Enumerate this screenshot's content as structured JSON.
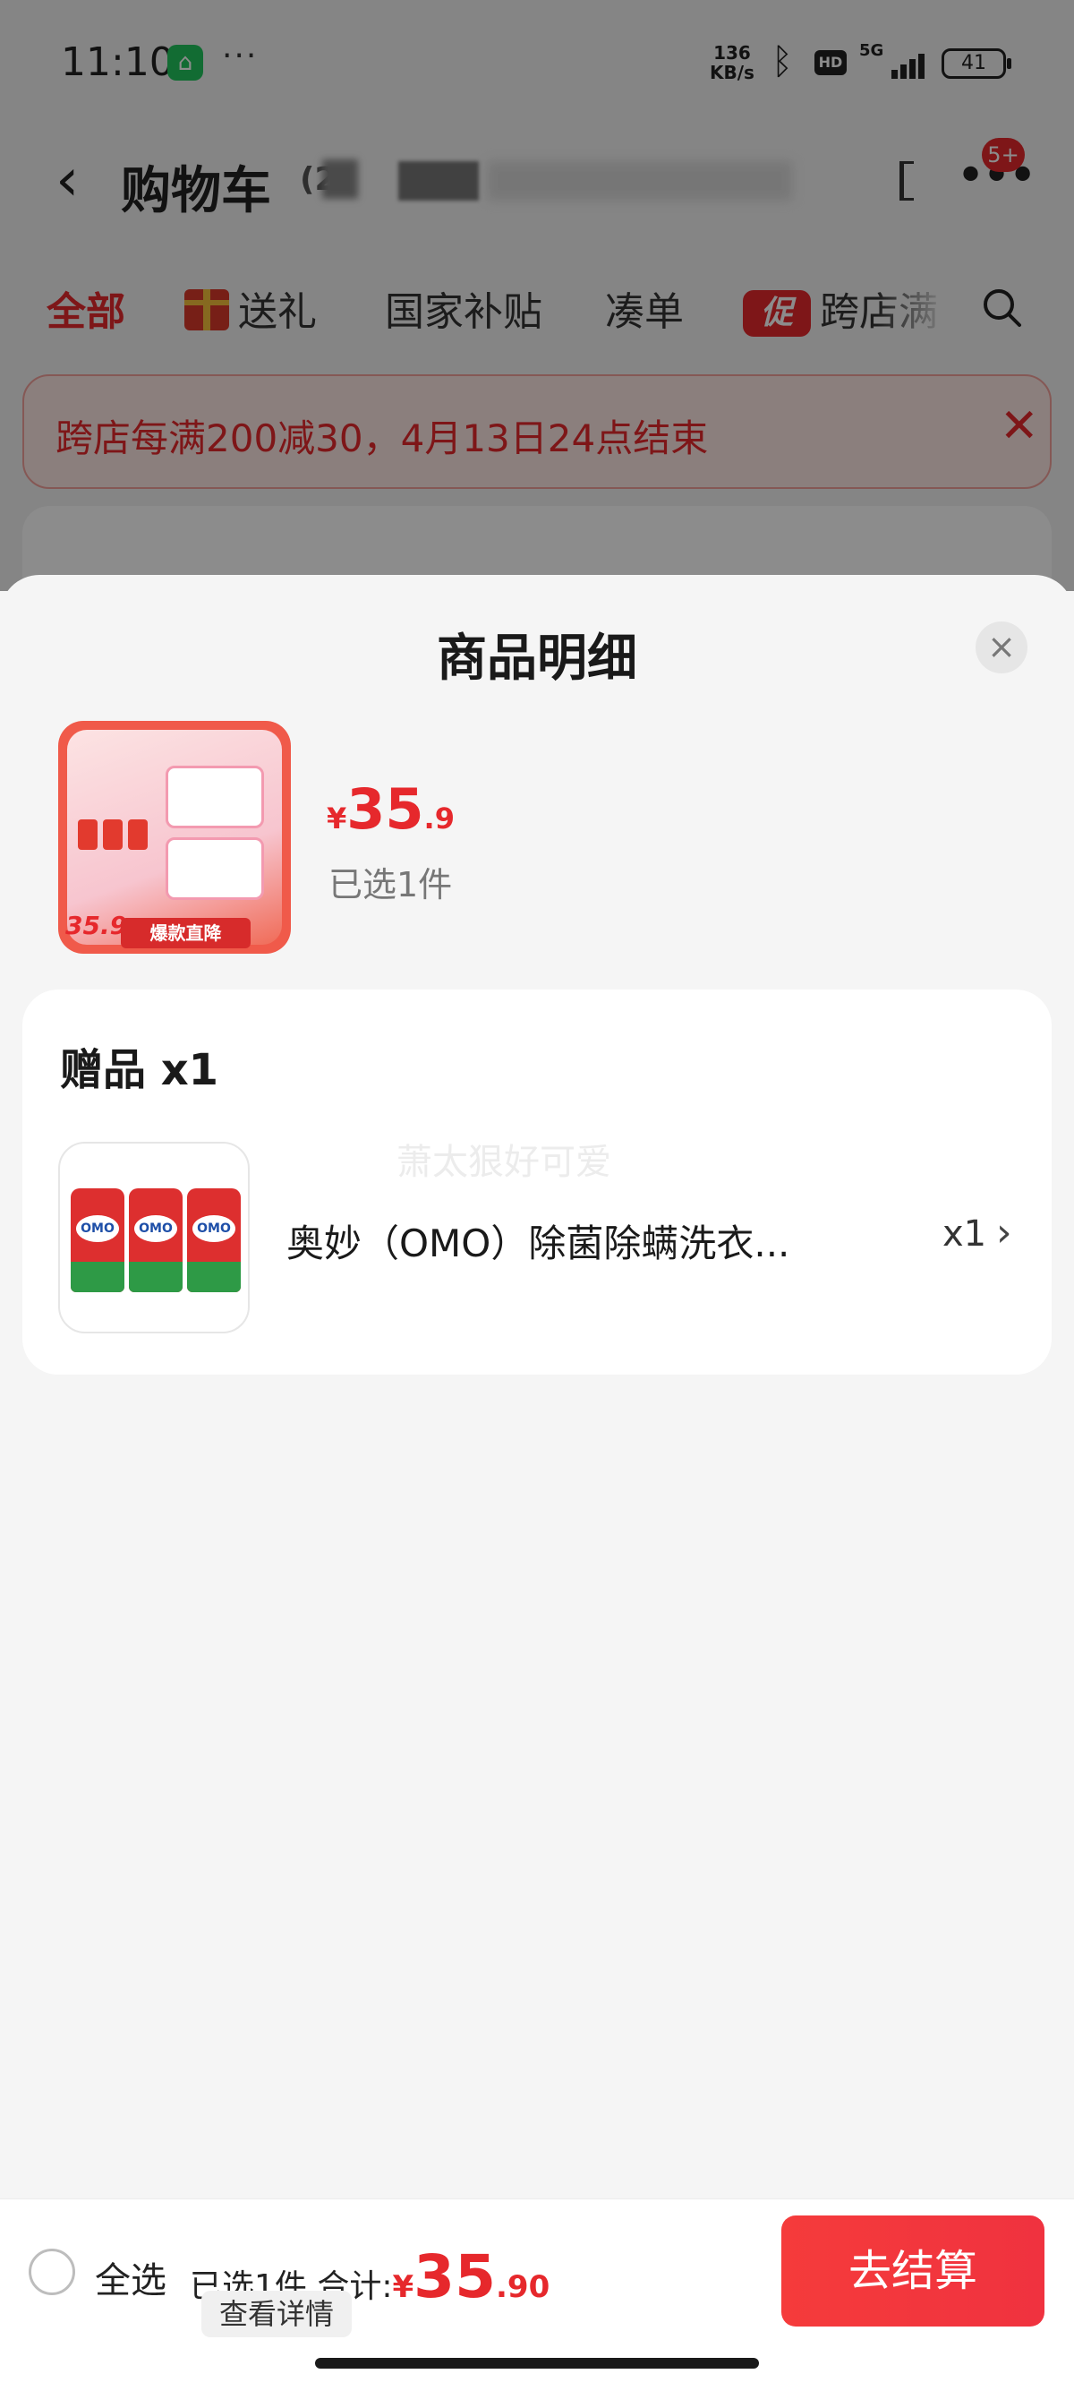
{
  "status_bar": {
    "time": "11:10",
    "more": "···",
    "net_speed_value": "136",
    "net_speed_unit": "KB/s",
    "hd": "HD",
    "signal": "5G",
    "battery": "41"
  },
  "navbar": {
    "title": "购物车",
    "count_prefix": "(2",
    "right_icon": "ledger-icon",
    "more_badge": "5+"
  },
  "tabs": [
    {
      "label": "全部",
      "active": true
    },
    {
      "label": "送礼",
      "icon": "gift-icon"
    },
    {
      "label": "国家补贴"
    },
    {
      "label": "凑单"
    },
    {
      "label": "跨店满",
      "badge": "促"
    }
  ],
  "promo": {
    "text": "跨店每满200减30，4月13日24点结束"
  },
  "sheet": {
    "title": "商品明细",
    "product": {
      "price_symbol": "¥",
      "price_int": "35",
      "price_dec": ".9",
      "selected_text": "已选1件",
      "thumb_price": "35.9",
      "thumb_banner": "爆款直降"
    },
    "gift": {
      "title": "赠品 x1",
      "watermark": "萧太狠好可爱",
      "name": "奥妙（OMO）除菌除螨洗衣...",
      "qty": "x1"
    }
  },
  "bottom_bar": {
    "select_all": "全选",
    "summary_prefix": "已选1件,合计:",
    "total_symbol": "¥",
    "total_int": "35",
    "total_dec": ".90",
    "details": "查看详情",
    "checkout": "去结算"
  },
  "colors": {
    "accent": "#e6282c",
    "checkout": "#f53b3b"
  }
}
